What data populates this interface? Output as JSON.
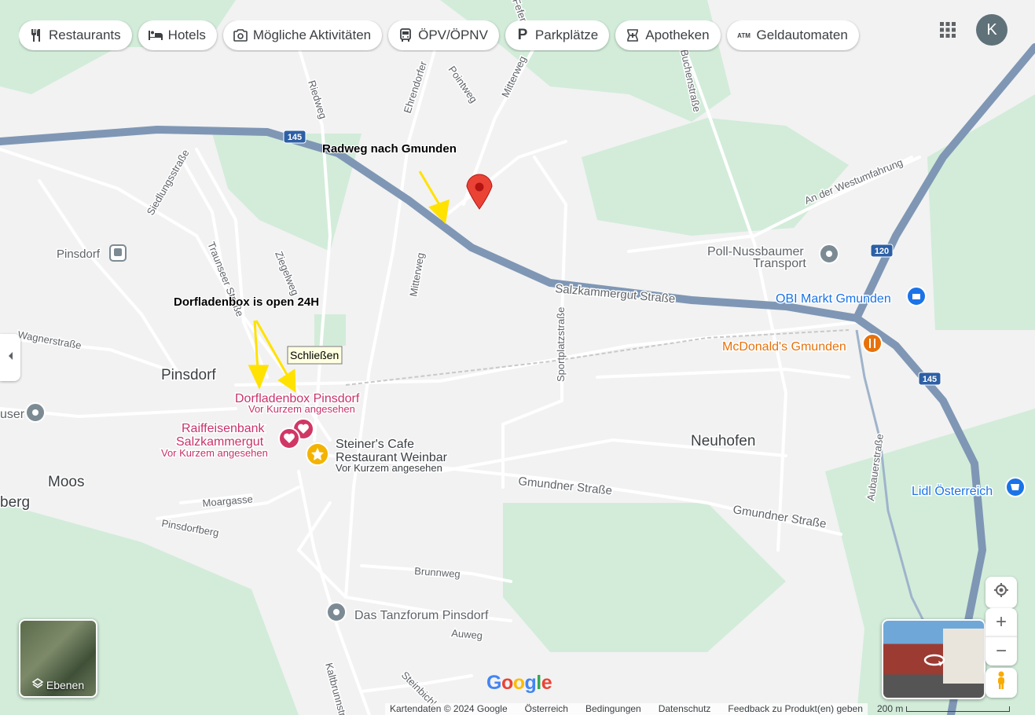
{
  "chips": [
    {
      "label": "Restaurants",
      "icon": "fork-knife-icon"
    },
    {
      "label": "Hotels",
      "icon": "bed-icon"
    },
    {
      "label": "Mögliche Aktivitäten",
      "icon": "camera-icon"
    },
    {
      "label": "ÖPV/ÖPNV",
      "icon": "bus-icon"
    },
    {
      "label": "Parkplätze",
      "icon": "parking-icon"
    },
    {
      "label": "Apotheken",
      "icon": "pharmacy-icon"
    },
    {
      "label": "Geldautomaten",
      "icon": "atm-icon"
    }
  ],
  "account": {
    "initial": "K"
  },
  "annotations": {
    "radweg": "Radweg nach Gmunden",
    "dorfladenbox": "Dorfladenbox is  open 24H",
    "tooltip": "Schließen"
  },
  "places": {
    "dorfladenbox": "Dorfladenbox Pinsdorf",
    "dorfladenbox_sub": "Vor Kurzem angesehen",
    "raiffeisen_1": "Raiffeisenbank",
    "raiffeisen_2": "Salzkammergut",
    "raiffeisen_sub": "Vor Kurzem angesehen",
    "steiner_1": "Steiner's Cafe",
    "steiner_2": "Restaurant Weinbar",
    "steiner_sub": "Vor Kurzem angesehen",
    "poll_1": "Poll-Nussbaumer",
    "poll_2": "Transport",
    "obi": "OBI Markt Gmunden",
    "mcdonalds": "McDonald's Gmunden",
    "lidl": "Lidl Österreich",
    "tanzforum": "Das Tanzforum Pinsdorf",
    "pinsdorf_station": "Pinsdorf"
  },
  "areas": {
    "pinsdorf": "Pinsdorf",
    "moos": "Moos",
    "neuhofen": "Neuhofen",
    "berg_partial": "berg",
    "user_partial": "user"
  },
  "streets": {
    "salzkammergut": "Salzkammergut Straße",
    "gmundner_1": "Gmundner Straße",
    "gmundner_2": "Gmundner Straße",
    "mitterweg_1": "Mitterweg",
    "mitterweg_2": "Mitterweg",
    "sportplatz": "Sportplatzstraße",
    "aubauer": "Aubauerstraße",
    "westumfahrung": "An der Westumfahrung",
    "siedlung": "Siedlungsstraße",
    "traunseer": "Traunseer Straße",
    "ziegelweg": "Ziegelweg",
    "riedweg": "Riedweg",
    "ehrendorfer": "Ehrendorfer",
    "pointweg": "Pointweg",
    "buchen": "Buchenstraße",
    "wagner": "Wagnerstraße",
    "moargasse": "Moargasse",
    "pinsdorfberg": "Pinsdorfberg",
    "brunnweg": "Brunnweg",
    "auweg": "Auweg",
    "kaltbrunn": "Kaltbrunnstr.",
    "steinbichl": "Steinbichl",
    "feferweg": "Feferweg"
  },
  "route_shields": {
    "r145_a": "145",
    "r145_b": "145",
    "r120": "120"
  },
  "layers_label": "Ebenen",
  "google_logo": "Google",
  "footer": [
    "Kartendaten © 2024 Google",
    "Österreich",
    "Bedingungen",
    "Datenschutz",
    "Feedback zu Produkt(en) geben"
  ],
  "scale_label": "200 m",
  "colors": {
    "highway": "#7f97b5",
    "greenspace": "#d2ecd9",
    "pin": "#ea4335",
    "annotation_arrow": "#ffe200",
    "poi_pink": "#d13764",
    "poi_orange": "#e8710a",
    "poi_blue": "#1a73e8"
  }
}
